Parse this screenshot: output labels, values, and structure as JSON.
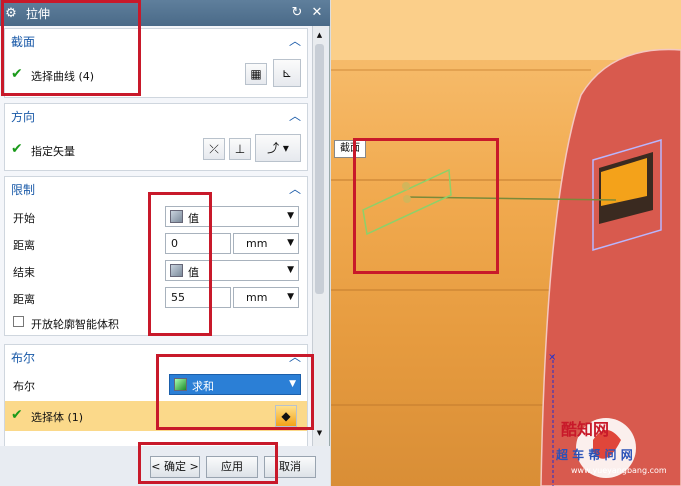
{
  "dialog": {
    "title": "拉伸",
    "sections": {
      "section": {
        "title": "截面",
        "select_curve_label": "选择曲线 (4)"
      },
      "direction": {
        "title": "方向",
        "vector_label": "指定矢量"
      },
      "limits": {
        "title": "限制",
        "start_label": "开始",
        "start_value": "值",
        "distance1_label": "距离",
        "distance1_value": "0",
        "unit1": "mm",
        "end_label": "结束",
        "end_value": "值",
        "distance2_label": "距离",
        "distance2_value": "55",
        "unit2": "mm",
        "open_profile_label": "开放轮廓智能体积"
      },
      "boolean": {
        "title": "布尔",
        "boolean_label": "布尔",
        "boolean_value": "求和",
        "select_body_label": "选择体 (1)"
      }
    },
    "buttons": {
      "ok": "< 确定 >",
      "apply": "应用",
      "cancel": "取消"
    }
  },
  "viewport": {
    "tag_label": "截面",
    "watermark_text": "酷知网",
    "brand_text": "超 车 帮 问 网",
    "watermark_url": "www.yueyangbang.com"
  },
  "colors": {
    "accent": "#1a5aa8",
    "annotation_red": "#c8192a",
    "selection_highlight": "#fbd98a",
    "boolean_combo": "#2b7fd6",
    "solid_face": "#d85a4e"
  }
}
